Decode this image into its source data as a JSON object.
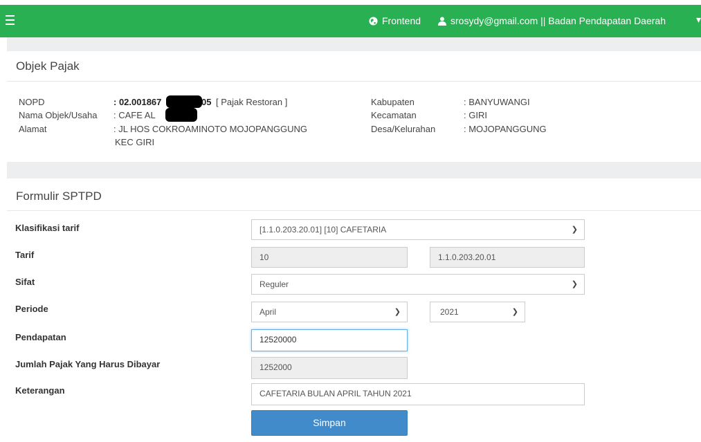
{
  "topbar": {
    "frontend_label": "Frontend",
    "user_label": "srosydy@gmail.com || Badan Pendapatan Daerah",
    "brand_color": "#28b053"
  },
  "objek_pajak": {
    "title": "Objek Pajak",
    "nopd_label": "NOPD",
    "nopd_prefix": ": 02.001867",
    "nopd_suffix": "05",
    "nopd_type": "[ Pajak Restoran ]",
    "nama_label": "Nama Objek/Usaha",
    "nama_value": ": CAFE AL",
    "alamat_label": "Alamat",
    "alamat_line1": ": JL HOS COKROAMINOTO MOJOPANGGUNG",
    "alamat_line2": "KEC GIRI",
    "kabupaten_label": "Kabupaten",
    "kabupaten_value": ": BANYUWANGI",
    "kecamatan_label": "Kecamatan",
    "kecamatan_value": ": GIRI",
    "desa_label": "Desa/Kelurahan",
    "desa_value": ": MOJOPANGGUNG"
  },
  "form": {
    "title": "Formulir SPTPD",
    "klasifikasi_label": "Klasifikasi tarif",
    "klasifikasi_value": "[1.1.0.203.20.01] [10] CAFETARIA",
    "tarif_label": "Tarif",
    "tarif_value": "10",
    "tarif_code": "1.1.0.203.20.01",
    "sifat_label": "Sifat",
    "sifat_value": "Reguler",
    "periode_label": "Periode",
    "periode_bulan": "April",
    "periode_tahun": "2021",
    "pendapatan_label": "Pendapatan",
    "pendapatan_value": "12520000",
    "jumlah_label": "Jumlah Pajak Yang Harus Dibayar",
    "jumlah_value": "1252000",
    "keterangan_label": "Keterangan",
    "keterangan_value": "CAFETARIA BULAN APRIL TAHUN 2021",
    "submit_label": "Simpan"
  }
}
